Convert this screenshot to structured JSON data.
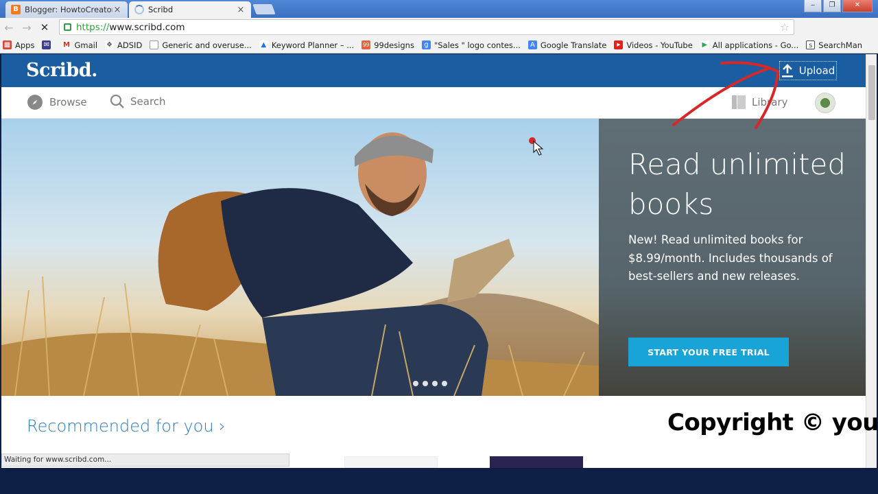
{
  "browser": {
    "tabs": [
      {
        "title": "Blogger: HowtoCreator - (",
        "active": false
      },
      {
        "title": "Scribd",
        "active": true
      }
    ],
    "close_glyph": "×",
    "window_buttons": [
      "‒",
      "❐",
      "✕"
    ],
    "url_scheme": "https://",
    "url_host": "www.scribd.com",
    "bookmarks": [
      {
        "label": "Apps",
        "icon": "apps-grid-icon",
        "color": "#d34836"
      },
      {
        "label": "",
        "icon": "mail-icon",
        "color": "#3b3b8f"
      },
      {
        "label": "Gmail",
        "icon": "gmail-icon",
        "color": "#d93025"
      },
      {
        "label": "ADSID",
        "icon": "puzzle-icon",
        "color": "#555555"
      },
      {
        "label": "Generic and overuse...",
        "icon": "page-icon",
        "color": "#9e9e9e"
      },
      {
        "label": "Keyword Planner – ...",
        "icon": "adwords-icon",
        "color": "#1a73e8"
      },
      {
        "label": "99designs",
        "icon": "99designs-icon",
        "color": "#e8603c"
      },
      {
        "label": "\"Sales \" logo contes...",
        "icon": "google-icon",
        "color": "#4285f4"
      },
      {
        "label": "Google Translate",
        "icon": "translate-icon",
        "color": "#4285f4"
      },
      {
        "label": "Videos - YouTube",
        "icon": "youtube-icon",
        "color": "#e62117"
      },
      {
        "label": "All applications - Go...",
        "icon": "play-icon",
        "color": "#34a853"
      },
      {
        "label": "SearchMan",
        "icon": "searchman-icon",
        "color": "#444444"
      }
    ]
  },
  "site": {
    "logo": "Scribd.",
    "upload_label": "Upload",
    "nav": {
      "browse": "Browse",
      "search": "Search",
      "library": "Library"
    },
    "hero": {
      "title": "Read unlimited books",
      "text": "New! Read unlimited books for $8.99/month. Includes thousands of best-sellers and new releases.",
      "cta": "START YOUR FREE TRIAL",
      "slide_count": 4
    },
    "recommended": "Recommended for you ›"
  },
  "status_text": "Waiting for www.scribd.com...",
  "watermark": "Copyright © youtu",
  "colors": {
    "header_blue": "#1a5da0",
    "cta_blue": "#19a4d8",
    "link_blue": "#2b7bbf",
    "annotation_red": "#d62828"
  }
}
